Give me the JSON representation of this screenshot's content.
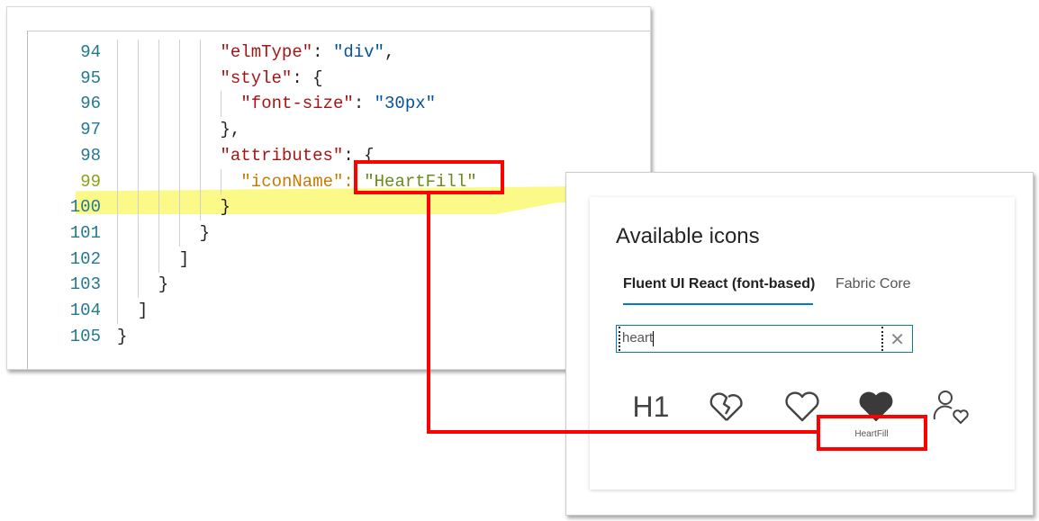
{
  "editor": {
    "lines": [
      {
        "num": "94",
        "parts": [
          {
            "t": "\"elmType\"",
            "c": "k"
          },
          {
            "t": ": ",
            "c": ""
          },
          {
            "t": "\"div\"",
            "c": "s"
          },
          {
            "t": ",",
            "c": ""
          }
        ]
      },
      {
        "num": "95",
        "parts": [
          {
            "t": "\"style\"",
            "c": "k"
          },
          {
            "t": ": {",
            "c": ""
          }
        ]
      },
      {
        "num": "96",
        "parts": [
          {
            "t": "\"font-size\"",
            "c": "k"
          },
          {
            "t": ": ",
            "c": ""
          },
          {
            "t": "\"30px\"",
            "c": "s"
          }
        ]
      },
      {
        "num": "97",
        "parts": [
          {
            "t": "},",
            "c": ""
          }
        ]
      },
      {
        "num": "98",
        "parts": [
          {
            "t": "\"attributes\"",
            "c": "k"
          },
          {
            "t": ": {",
            "c": ""
          }
        ]
      },
      {
        "num": "99",
        "parts": [
          {
            "t": "\"iconName\"",
            "c": "kh"
          },
          {
            "t": ": ",
            "c": "kh"
          },
          {
            "t": "\"HeartFill\"",
            "c": "sh"
          }
        ]
      },
      {
        "num": "100",
        "parts": [
          {
            "t": "}",
            "c": ""
          }
        ]
      },
      {
        "num": "101",
        "parts": [
          {
            "t": "}",
            "c": ""
          }
        ]
      },
      {
        "num": "102",
        "parts": [
          {
            "t": "]",
            "c": ""
          }
        ]
      },
      {
        "num": "103",
        "parts": [
          {
            "t": "}",
            "c": ""
          }
        ]
      },
      {
        "num": "104",
        "parts": [
          {
            "t": "]",
            "c": ""
          }
        ]
      },
      {
        "num": "105",
        "parts": [
          {
            "t": "}",
            "c": ""
          }
        ]
      }
    ],
    "highlighted_line": "99"
  },
  "icon_panel": {
    "title": "Available icons",
    "tabs": [
      {
        "label": "Fluent UI React (font-based)",
        "active": true
      },
      {
        "label": "Fabric Core",
        "active": false
      }
    ],
    "search": {
      "value": "heart"
    },
    "icons": [
      {
        "name": "Header1",
        "glyph": "H1"
      },
      {
        "name": "HeartBroken"
      },
      {
        "name": "Heart"
      },
      {
        "name": "HeartFill"
      },
      {
        "name": "FollowUser-heart"
      }
    ],
    "hover_label": "HeartFill"
  },
  "colors": {
    "annotation": "#ff0000",
    "highlight": "#fbfa7c",
    "accent": "#0078d4"
  }
}
